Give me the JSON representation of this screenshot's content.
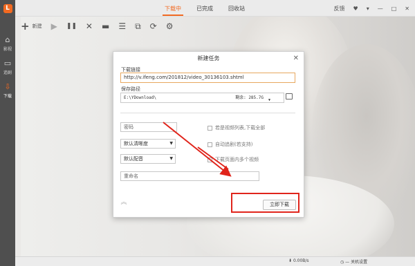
{
  "sidebar": {
    "logo": "L",
    "items": [
      {
        "label": "影视",
        "icon": "home-icon",
        "glyph": "⌂"
      },
      {
        "label": "追剧",
        "icon": "tv-icon",
        "glyph": "▭"
      },
      {
        "label": "下载",
        "icon": "download-icon",
        "glyph": "⇩"
      }
    ]
  },
  "tabs": [
    "下载中",
    "已完成",
    "回收站"
  ],
  "window_controls": {
    "feedback": "反馈",
    "shirt": "♥",
    "menu": "▾",
    "minimize": "—",
    "maximize": "□",
    "close": "✕"
  },
  "toolbar": {
    "new_label": "新建",
    "play": "▶",
    "pause": "❚❚",
    "delete": "✕",
    "folder": "▬",
    "list": "☰",
    "copy": "⧉",
    "refresh": "⟳",
    "settings": "⚙"
  },
  "dialog": {
    "title": "新建任务",
    "close": "✕",
    "url_label": "下载链接",
    "url_value": "http://v.ifeng.com/201812/video_30136103.shtml",
    "path_label": "保存路径",
    "path_value": "E:\\YDownload\\",
    "free_space": "剩余: 285.7G",
    "password_placeholder": "密码",
    "resolution": "默认清晰度",
    "audio": "默认配音",
    "rename_placeholder": "重命名",
    "check_playlist": "若是视频列表,下载全部",
    "check_subtitle": "自动追剧(若支持)",
    "check_multi": "下载页面内多个视频",
    "expand": "︽",
    "start_button": "立即下载"
  },
  "status": {
    "speed": "0.00B/s",
    "shutdown": "关机设置"
  },
  "colors": {
    "accent": "#f26a21",
    "highlight": "#e0241b"
  }
}
